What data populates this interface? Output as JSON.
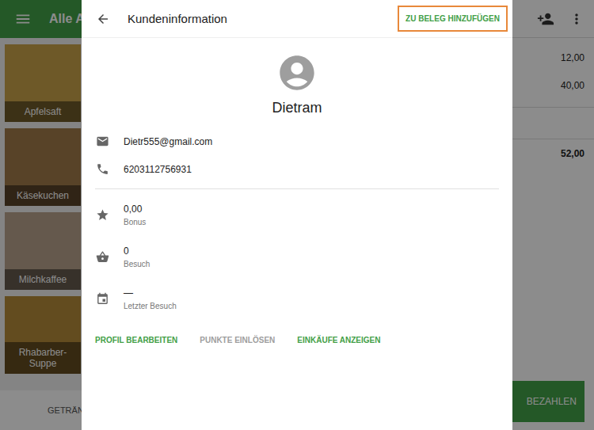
{
  "background": {
    "category_title": "Alle Ar",
    "products": [
      {
        "label": "Apfelsaft"
      },
      {
        "label": "Käsekuchen"
      },
      {
        "label": "Milchkaffee"
      },
      {
        "label": "Rhabarber-Suppe"
      }
    ],
    "category_tab": "GETRÄNK",
    "ticket": {
      "prices": [
        "12,00",
        "40,00"
      ],
      "total": "52,00",
      "pay_button": "BEZAHLEN"
    }
  },
  "dialog": {
    "title": "Kundeninformation",
    "add_button": {
      "label": "ZU BELEG HINZUFÜGEN",
      "highlighted": true
    },
    "customer_name": "Dietram",
    "contacts": [
      {
        "kind": "email",
        "value": "Dietr555@gmail.com"
      },
      {
        "kind": "phone",
        "value": "6203112756931"
      }
    ],
    "stats": [
      {
        "kind": "bonus",
        "value": "0,00",
        "label": "Bonus"
      },
      {
        "kind": "visits",
        "value": "0",
        "label": "Besuch"
      },
      {
        "kind": "last-visit",
        "value": "—",
        "label": "Letzter Besuch"
      }
    ],
    "actions": [
      {
        "label": "PROFIL BEARBEITEN",
        "disabled": false
      },
      {
        "label": "PUNKTE EINLÖSEN",
        "disabled": true
      },
      {
        "label": "EINKÄUFE ANZEIGEN",
        "disabled": false
      }
    ]
  }
}
